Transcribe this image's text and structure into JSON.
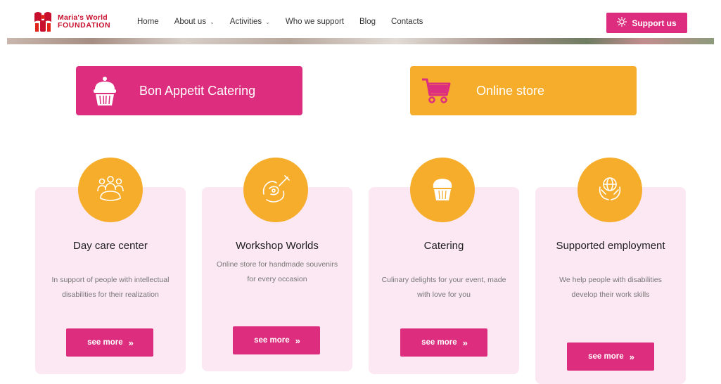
{
  "header": {
    "logo_line1": "Maria's World",
    "logo_line2": "FOUNDATION",
    "nav": [
      {
        "label": "Home"
      },
      {
        "label": "About us"
      },
      {
        "label": "Activities"
      },
      {
        "label": "Who we support"
      },
      {
        "label": "Blog"
      },
      {
        "label": "Contacts"
      }
    ],
    "support_label": "Support us"
  },
  "banners": {
    "catering_label": "Bon Appetit Catering",
    "store_label": "Online store"
  },
  "cards": [
    {
      "title": "Day care center",
      "desc": "In support of people with intellectual disabilities for their realization",
      "button": "see more",
      "icon": "people-icon"
    },
    {
      "title": "Workshop Worlds",
      "desc": "Online store for handmade souvenirs for every occasion",
      "button": "see more",
      "icon": "craft-hands-icon"
    },
    {
      "title": "Catering",
      "desc": "Culinary delights for your event, made with love for you",
      "button": "see more",
      "icon": "cupcake-icon"
    },
    {
      "title": "Supported employment",
      "desc": "We help people with disabilities develop their work skills",
      "button": "see more",
      "icon": "globe-hands-icon"
    }
  ],
  "colors": {
    "brand_pink": "#dc2d7f",
    "brand_orange": "#f6ad2c",
    "card_bg": "#fce8f2"
  }
}
